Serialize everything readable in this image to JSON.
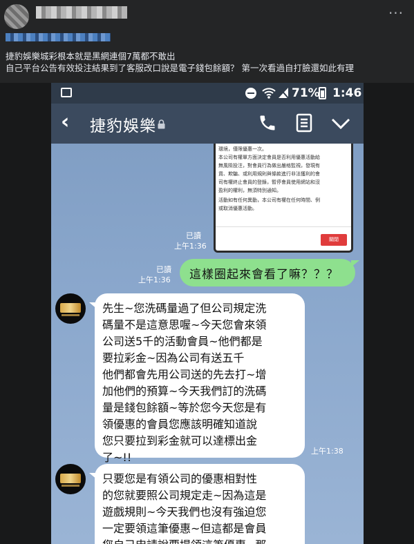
{
  "post": {
    "caption_line_1": "捷豹娛樂城彩根本就是黑網連個7萬都不敢出",
    "caption_line_2": "自己平台公告有效投注結果到了客服改口說是電子錢包餘額？ 第一次看過自打臉還如此有理",
    "more_glyph": "···"
  },
  "status_bar": {
    "battery": "71%",
    "time": "1:46"
  },
  "chat_header": {
    "title": "捷豹娛樂",
    "back_glyph": "‹"
  },
  "image_message": {
    "lines": [
      "環境，僅限優惠一次。",
      "本公司有權單方面決定會員是否利用優惠活動給",
      "無風險投注，對會員行為做出嚴格監視，發現有",
      "貨、欺騙、或利用規則與條款進行非法獲利的會",
      "司有權終止會員的登錄，暫停會員使用網站和沒",
      "盈利的權利，無須特別通知。",
      "活動如有任何異動，本公司有權在任何時間、例",
      "或取消優惠活動。"
    ],
    "close_label": "關閉",
    "read_label": "已讀",
    "time": "上午1:36"
  },
  "outgoing_message": {
    "text": "這樣圈起來會看了嘛？？？",
    "read_label": "已讀",
    "time": "上午1:36"
  },
  "incoming_messages": [
    {
      "lines": [
        "先生~您洗碼量過了但公司規定洗",
        "碼量不是這意思喔~今天您會來領",
        "公司送5千的活動會員~他們都是",
        "要拉彩金~因為公司有送五千",
        "他們都會先用公司送的先去打~增",
        "加他們的預算~今天我們訂的洗碼",
        "量是錢包餘額~等於您今天您是有",
        "領優惠的會員您應該明確知道說",
        "您只要拉到彩金就可以達標出金",
        "了~!!"
      ],
      "time": "上午1:38"
    },
    {
      "lines": [
        "只要您是有領公司的優惠相對性",
        "的您就要照公司規定走~因為這是",
        "遊戲規則~今天我們也沒有強迫您",
        "一定要領這筆優惠~但這都是會員",
        "您自己申請說要提領這筆優惠~那"
      ]
    }
  ]
}
